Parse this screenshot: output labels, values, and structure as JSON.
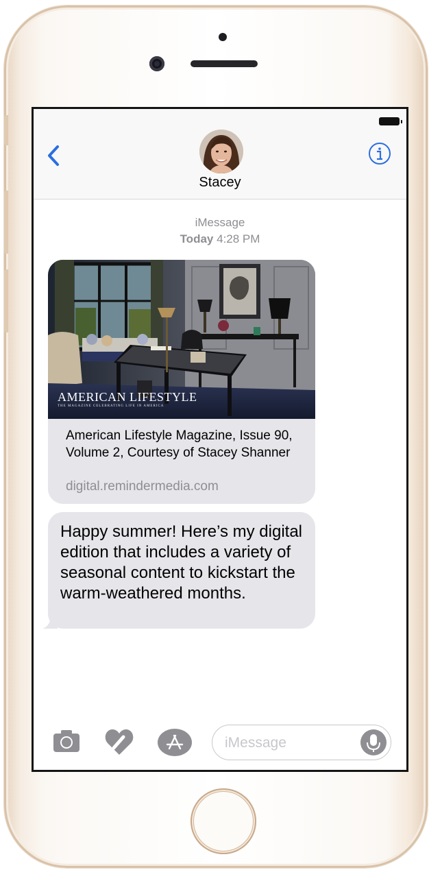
{
  "contact": {
    "name": "Stacey"
  },
  "thread": {
    "service": "iMessage",
    "day": "Today",
    "time": "4:28 PM"
  },
  "link_preview": {
    "image_title": "AMERICAN LIFESTYLE",
    "image_subtitle": "THE MAGAZINE CELEBRATING LIFE IN AMERICA",
    "title": "American Lifestyle Magazine, Issue 90, Volume 2, Courtesy of Stacey Shanner",
    "domain": "digital.remindermedia.com"
  },
  "message": {
    "text": "Happy summer! Here’s my digital edition that includes a variety of seasonal content to kickstart the warm-weathered months."
  },
  "composer": {
    "placeholder": "iMessage"
  },
  "icons": {
    "back": "chevron-left-icon",
    "info": "info-icon",
    "camera": "camera-icon",
    "digital_touch": "heart-icon",
    "apps": "app-store-icon",
    "mic": "microphone-icon"
  },
  "colors": {
    "accent": "#2b6ee0",
    "bubble": "#e5e5ea",
    "meta": "#8e8e93"
  }
}
